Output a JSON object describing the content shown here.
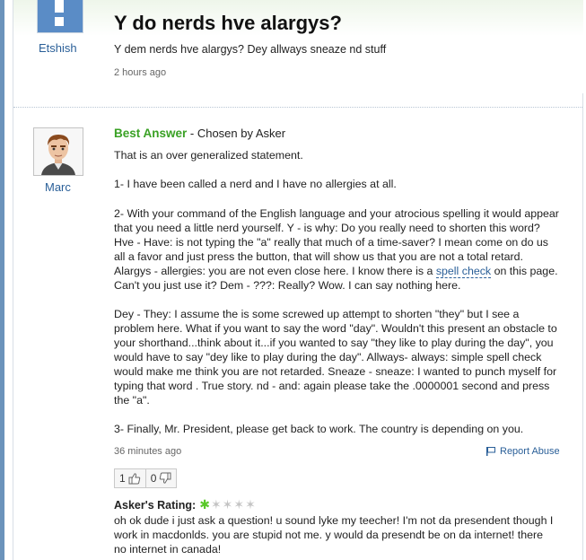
{
  "question": {
    "username": "Etshish",
    "avatar_icon": "exclamation-icon",
    "title": "Y do nerds hve alargys?",
    "body": "Y dem nerds hve alargys? Dey allways sneaze nd stuff",
    "time": "2 hours ago"
  },
  "answer": {
    "username": "Marc",
    "best_answer_label": "Best Answer",
    "chosen_by": " - Chosen by Asker",
    "p1": "That is an over generalized statement.",
    "p2": "1- I have been called a nerd and I have no allergies at all.",
    "p3_before_link": "2- With your command of the English language and your atrocious spelling it would appear that you need a little nerd yourself. Y - is why: Do you really need to shorten this word? Hve - Have: is not typing the \"a\" really that much of a time-saver? I mean come on do us all a favor and just press the button, that will show us that you are not a total retard. Alargys - allergies: you are not even close here. I know there is a ",
    "p3_link": "spell check",
    "p3_after_link": " on this page. Can't you just use it? Dem - ???: Really? Wow. I can say nothing here.",
    "p4": "Dey - They: I assume the is some screwed up attempt to shorten \"they\" but I see a problem here. What if you want to say the word \"day\". Wouldn't this present an obstacle to your shorthand...think about it...if you wanted to say \"they like to play during the day\", you would have to say \"dey like to play during the day\". Allways- always: simple spell check would make me think you are not retarded. Sneaze - sneaze: I wanted to punch myself for typing that word . True story. nd - and: again please take the .0000001 second and press the \"a\".",
    "p5": "3- Finally, Mr. President, please get back to work. The country is depending on you.",
    "time": "36 minutes ago",
    "report_label": "Report Abuse",
    "thumbs_up_count": "1",
    "thumbs_down_count": "0"
  },
  "rating": {
    "label": "Asker's Rating:",
    "stars": 1,
    "max_stars": 5,
    "comment": "oh ok dude i just ask a question! u sound lyke my teecher! I'm not da presendent though I work in macdonlds. you are stupid not me. y would da presendt be on da internet! there no internet in canada!"
  },
  "colors": {
    "best_answer": "#3aa125",
    "link": "#2a5f98",
    "star_on": "#59c829",
    "star_off": "#c3c3c3",
    "left_bar": "#6b93bb"
  }
}
